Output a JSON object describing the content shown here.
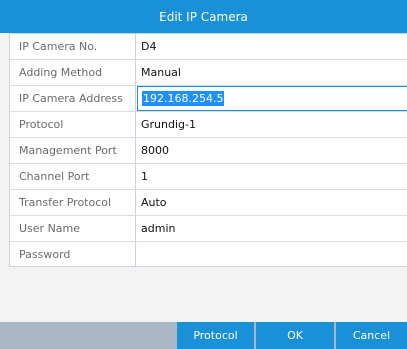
{
  "window": {
    "title": "Edit IP Camera"
  },
  "form": {
    "rows": [
      {
        "label": "IP Camera No.",
        "value": "D4"
      },
      {
        "label": "Adding Method",
        "value": "Manual"
      },
      {
        "label": "IP Camera Address",
        "value": "192.168.254.5"
      },
      {
        "label": "Protocol",
        "value": "Grundig-1"
      },
      {
        "label": "Management Port",
        "value": "8000"
      },
      {
        "label": "Channel Port",
        "value": "1"
      },
      {
        "label": "Transfer Protocol",
        "value": "Auto"
      },
      {
        "label": "User Name",
        "value": "admin"
      },
      {
        "label": "Password",
        "value": ""
      }
    ]
  },
  "buttons": {
    "protocol": "Protocol",
    "ok": "OK",
    "cancel": "Cancel"
  },
  "colors": {
    "accent": "#1a90d8",
    "footer": "#aab7c6",
    "selection": "#1e90ff"
  }
}
